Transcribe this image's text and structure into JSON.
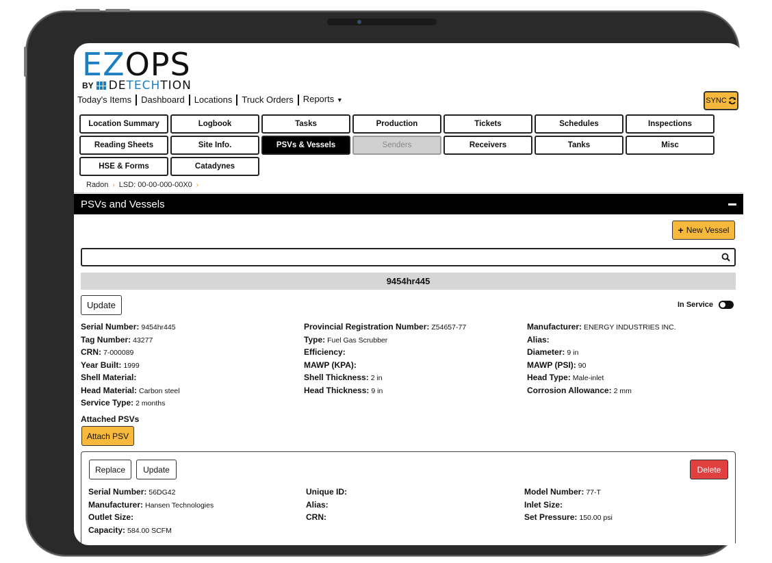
{
  "logo": {
    "ez": "EZ",
    "ops": "OPS",
    "by": "BY",
    "det_a": "DE",
    "det_b": "TECH",
    "det_c": "TION"
  },
  "topnav": [
    {
      "label": "Today's Items"
    },
    {
      "label": "Dashboard"
    },
    {
      "label": "Locations"
    },
    {
      "label": "Truck Orders"
    },
    {
      "label": "Reports"
    }
  ],
  "sync_label": "SYNC",
  "tabs": {
    "location_summary": "Location Summary",
    "logbook": "Logbook",
    "tasks": "Tasks",
    "production": "Production",
    "tickets": "Tickets",
    "schedules": "Schedules",
    "inspections": "Inspections",
    "reading_sheets": "Reading Sheets",
    "site_info": "Site Info.",
    "psvs_vessels": "PSVs & Vessels",
    "senders": "Senders",
    "receivers": "Receivers",
    "tanks": "Tanks",
    "misc": "Misc",
    "hse_forms": "HSE & Forms",
    "catadynes": "Catadynes"
  },
  "breadcrumb": {
    "level1": "Radon",
    "level2": "LSD: 00-00-000-00X0"
  },
  "section": {
    "title": "PSVs and Vessels"
  },
  "new_vessel_label": "New Vessel",
  "search": {
    "value": "",
    "placeholder": ""
  },
  "vessel": {
    "name": "9454hr445",
    "update_label": "Update",
    "in_service_label": "In Service",
    "fields": {
      "serial_number": {
        "k": "Serial Number:",
        "v": "9454hr445"
      },
      "tag_number": {
        "k": "Tag Number:",
        "v": "43277"
      },
      "crn": {
        "k": "CRN:",
        "v": "7-000089"
      },
      "year_built": {
        "k": "Year Built:",
        "v": "1999"
      },
      "shell_material": {
        "k": "Shell Material:",
        "v": ""
      },
      "head_material": {
        "k": "Head Material:",
        "v": "Carbon steel"
      },
      "service_type": {
        "k": "Service Type:",
        "v": "2 months"
      },
      "prov_reg": {
        "k": "Provincial Registration Number:",
        "v": "Z54657-77"
      },
      "type": {
        "k": "Type:",
        "v": "Fuel Gas Scrubber"
      },
      "efficiency": {
        "k": "Efficiency:",
        "v": ""
      },
      "mawp_kpa": {
        "k": "MAWP (KPA):",
        "v": ""
      },
      "shell_thickness": {
        "k": "Shell Thickness:",
        "v": "2 in"
      },
      "head_thickness": {
        "k": "Head Thickness:",
        "v": "9 in"
      },
      "manufacturer": {
        "k": "Manufacturer:",
        "v": "ENERGY INDUSTRIES INC."
      },
      "alias": {
        "k": "Alias:",
        "v": ""
      },
      "diameter": {
        "k": "Diameter:",
        "v": "9 in"
      },
      "mawp_psi": {
        "k": "MAWP (PSI):",
        "v": "90"
      },
      "head_type": {
        "k": "Head Type:",
        "v": "Male-inlet"
      },
      "corrosion": {
        "k": "Corrosion Allowance:",
        "v": "2 mm"
      }
    }
  },
  "attached": {
    "label": "Attached PSVs",
    "attach_label": "Attach PSV"
  },
  "psv": {
    "replace_label": "Replace",
    "update_label": "Update",
    "delete_label": "Delete",
    "fields": {
      "serial_number": {
        "k": "Serial Number:",
        "v": "56DG42"
      },
      "manufacturer": {
        "k": "Manufacturer:",
        "v": "Hansen Technologies"
      },
      "outlet_size": {
        "k": "Outlet Size:",
        "v": ""
      },
      "capacity": {
        "k": "Capacity:",
        "v": "584.00 SCFM"
      },
      "unique_id": {
        "k": "Unique ID:",
        "v": ""
      },
      "alias": {
        "k": "Alias:",
        "v": ""
      },
      "crn": {
        "k": "CRN:",
        "v": ""
      },
      "model_number": {
        "k": "Model Number:",
        "v": "77-T"
      },
      "inlet_size": {
        "k": "Inlet Size:",
        "v": ""
      },
      "set_pressure": {
        "k": "Set Pressure:",
        "v": "150.00 psi"
      }
    }
  },
  "colors": {
    "accent": "#f6b93b",
    "brand_blue": "#1d7fc0",
    "delete": "#e04040",
    "active_tab": "#000000"
  }
}
